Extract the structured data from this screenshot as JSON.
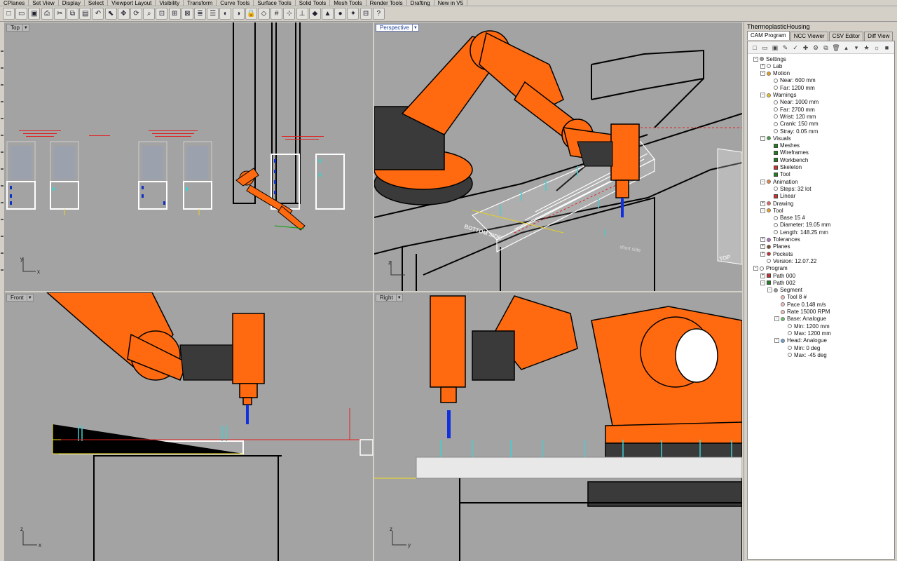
{
  "menu_tabs": [
    "CPlanes",
    "Set View",
    "Display",
    "Select",
    "Viewport Layout",
    "Visibility",
    "Transform",
    "Curve Tools",
    "Surface Tools",
    "Solid Tools",
    "Mesh Tools",
    "Render Tools",
    "Drafting",
    "New in V5"
  ],
  "toolbar_icons": [
    "new-icon",
    "open-icon",
    "save-icon",
    "print-icon",
    "cut-icon",
    "copy-icon",
    "paste-icon",
    "undo-icon",
    "select-icon",
    "pan-icon",
    "rotate-icon",
    "zoom-icon",
    "zoom-window-icon",
    "zoom-extents-icon",
    "zoom-selected-icon",
    "layer-icon",
    "properties-icon",
    "hide-icon",
    "show-icon",
    "lock-icon",
    "unlock-icon",
    "grid-icon",
    "snap-icon",
    "ortho-icon",
    "render-icon",
    "material-icon",
    "sphere-icon",
    "light-icon",
    "split-icon",
    "help-icon"
  ],
  "viewports": {
    "top": "Top",
    "perspective": "Perspective",
    "front": "Front",
    "right": "Right"
  },
  "axes": {
    "x": "x",
    "y": "y",
    "z": "z"
  },
  "scene_labels": {
    "bottom_side": "BOTTOM SIDE",
    "short_side": "short side",
    "top": "TOP"
  },
  "panel": {
    "title": "ThermoplasticHousing",
    "tabs": [
      "CAM Program",
      "NCC Viewer",
      "CSV Editor",
      "Diff View"
    ],
    "active_tab": "CAM Program"
  },
  "tree": [
    {
      "label": "Settings",
      "level": 0,
      "exp": "-",
      "icon": "dot",
      "color": "#999999"
    },
    {
      "label": "Lab",
      "level": 1,
      "exp": "+",
      "icon": "dot",
      "color": "#ffffff"
    },
    {
      "label": "Motion",
      "level": 1,
      "exp": "-",
      "icon": "dot",
      "color": "#e8a020"
    },
    {
      "label": "Near: 600 mm",
      "level": 2,
      "exp": "",
      "icon": "dot",
      "color": "#ffffff"
    },
    {
      "label": "Far: 1200 mm",
      "level": 2,
      "exp": "",
      "icon": "dot",
      "color": "#ffffff"
    },
    {
      "label": "Warnings",
      "level": 1,
      "exp": "-",
      "icon": "dot",
      "color": "#e8c020"
    },
    {
      "label": "Near: 1000 mm",
      "level": 2,
      "exp": "",
      "icon": "dot",
      "color": "#ffffff"
    },
    {
      "label": "Far: 2700 mm",
      "level": 2,
      "exp": "",
      "icon": "dot",
      "color": "#ffffff"
    },
    {
      "label": "Wrist: 120 mm",
      "level": 2,
      "exp": "",
      "icon": "dot",
      "color": "#ffffff"
    },
    {
      "label": "Crank: 150 mm",
      "level": 2,
      "exp": "",
      "icon": "dot",
      "color": "#ffffff"
    },
    {
      "label": "Stray: 0.05 mm",
      "level": 2,
      "exp": "",
      "icon": "dot",
      "color": "#ffffff"
    },
    {
      "label": "Visuals",
      "level": 1,
      "exp": "-",
      "icon": "dot",
      "color": "#40a040"
    },
    {
      "label": "Meshes",
      "level": 2,
      "exp": "",
      "icon": "sq",
      "color": "#208020"
    },
    {
      "label": "Wireframes",
      "level": 2,
      "exp": "",
      "icon": "sq",
      "color": "#208020"
    },
    {
      "label": "Workbench",
      "level": 2,
      "exp": "",
      "icon": "sq",
      "color": "#208020"
    },
    {
      "label": "Skeleton",
      "level": 2,
      "exp": "",
      "icon": "sq",
      "color": "#d03030"
    },
    {
      "label": "Tool",
      "level": 2,
      "exp": "",
      "icon": "sq",
      "color": "#208020"
    },
    {
      "label": "Animation",
      "level": 1,
      "exp": "-",
      "icon": "dot",
      "color": "#e88040"
    },
    {
      "label": "Steps:  32 lot",
      "level": 2,
      "exp": "",
      "icon": "dot",
      "color": "#ffffff"
    },
    {
      "label": "Linear",
      "level": 2,
      "exp": "",
      "icon": "sq",
      "color": "#d03030"
    },
    {
      "label": "Drawing",
      "level": 1,
      "exp": "+",
      "icon": "dot",
      "color": "#e86060"
    },
    {
      "label": "Tool",
      "level": 1,
      "exp": "-",
      "icon": "dot",
      "color": "#e8a020"
    },
    {
      "label": "Base 15 #",
      "level": 2,
      "exp": "",
      "icon": "dot",
      "color": "#ffffff"
    },
    {
      "label": "Diameter: 19.05 mm",
      "level": 2,
      "exp": "",
      "icon": "dot",
      "color": "#ffffff"
    },
    {
      "label": "Length: 148.25 mm",
      "level": 2,
      "exp": "",
      "icon": "dot",
      "color": "#ffffff"
    },
    {
      "label": "Tolerances",
      "level": 1,
      "exp": "+",
      "icon": "dot",
      "color": "#b070c0"
    },
    {
      "label": "Planes",
      "level": 1,
      "exp": "+",
      "icon": "dot",
      "color": "#7a4a30"
    },
    {
      "label": "Pockets",
      "level": 1,
      "exp": "+",
      "icon": "dot",
      "color": "#c03030"
    },
    {
      "label": "Version: 12.07.22",
      "level": 1,
      "exp": "",
      "icon": "dot",
      "color": "#ffffff"
    },
    {
      "label": "Program",
      "level": 0,
      "exp": "-",
      "icon": "dot",
      "color": "#ffffff"
    },
    {
      "label": "Path 000",
      "level": 1,
      "exp": "+",
      "icon": "sq",
      "color": "#c03030"
    },
    {
      "label": "Path 002",
      "level": 1,
      "exp": "-",
      "icon": "sq",
      "color": "#208020"
    },
    {
      "label": "Segment",
      "level": 2,
      "exp": "-",
      "icon": "dot",
      "color": "#999999"
    },
    {
      "label": "Tool 8 #",
      "level": 3,
      "exp": "",
      "icon": "dot",
      "color": "#f0c0c0"
    },
    {
      "label": "Pace 0.148 m/s",
      "level": 3,
      "exp": "",
      "icon": "dot",
      "color": "#f0c0c0"
    },
    {
      "label": "Rate 15000 RPM",
      "level": 3,
      "exp": "",
      "icon": "dot",
      "color": "#f0c0c0"
    },
    {
      "label": "Base: Analogue",
      "level": 3,
      "exp": "-",
      "icon": "dot",
      "color": "#70c070"
    },
    {
      "label": "Min: 1200 mm",
      "level": 4,
      "exp": "",
      "icon": "dot",
      "color": "#ffffff"
    },
    {
      "label": "Max: 1200 mm",
      "level": 4,
      "exp": "",
      "icon": "dot",
      "color": "#ffffff"
    },
    {
      "label": "Head: Analogue",
      "level": 3,
      "exp": "-",
      "icon": "dot",
      "color": "#70a0d0"
    },
    {
      "label": "Min: 0 deg",
      "level": 4,
      "exp": "",
      "icon": "dot",
      "color": "#ffffff"
    },
    {
      "label": "Max: -45 deg",
      "level": 4,
      "exp": "",
      "icon": "dot",
      "color": "#ffffff"
    }
  ],
  "colors": {
    "robot": "#ff6a10",
    "robot_dark": "#3a3a3a",
    "viewport_bg": "#a3a3a3",
    "toolpath": "#40d0d0",
    "spindle": "#1030e0"
  }
}
